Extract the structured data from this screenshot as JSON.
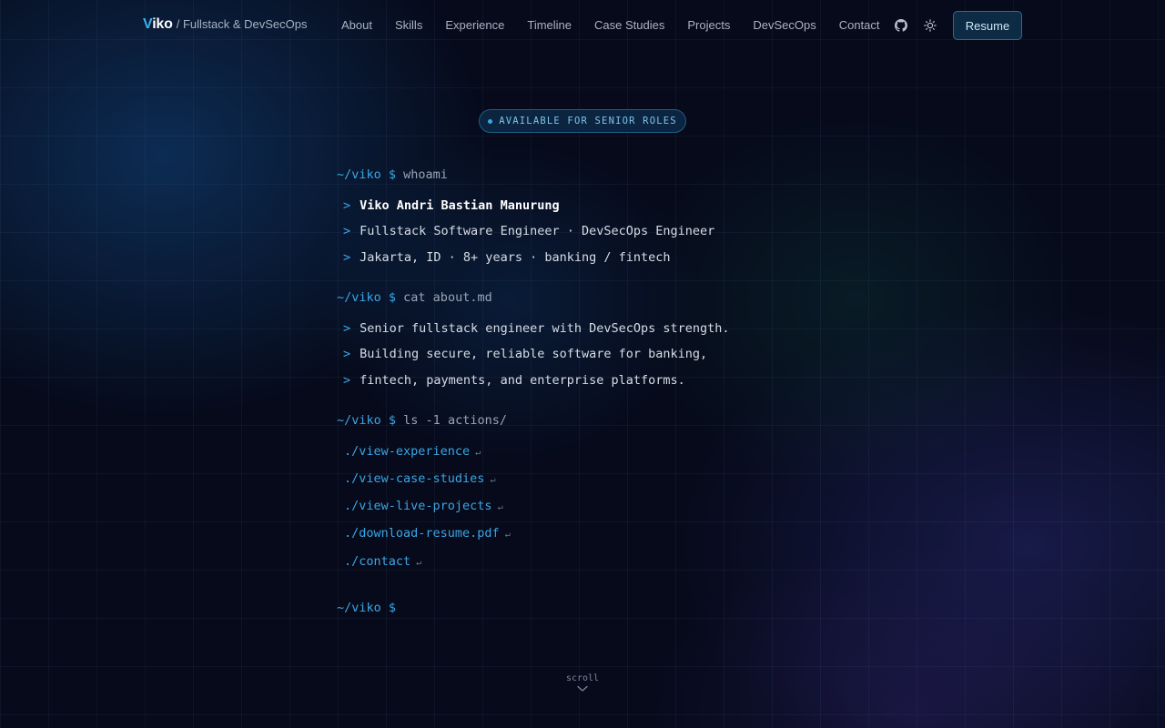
{
  "nav": {
    "brand_name": "iko",
    "brand_initial": "V",
    "brand_sub": "/ Fullstack & DevSecOps",
    "links": [
      "About",
      "Skills",
      "Experience",
      "Timeline",
      "Case Studies",
      "Projects",
      "DevSecOps",
      "Contact"
    ],
    "github_icon": "github-icon",
    "theme_icon": "sun-icon",
    "resume_label": "Resume"
  },
  "badge": {
    "label": "AVAILABLE FOR SENIOR ROLES"
  },
  "terminal": {
    "path": "~/viko $",
    "blocks": [
      {
        "command": "whoami",
        "lines": [
          "Viko Andri Bastian Manurung",
          "Fullstack Software Engineer · DevSecOps Engineer",
          "Jakarta, ID · 8+ years · banking / fintech"
        ]
      },
      {
        "command": "cat about.md",
        "lines": [
          "Senior fullstack engineer with DevSecOps strength.",
          "Building secure, reliable software for banking,",
          "fintech, payments, and enterprise platforms."
        ]
      },
      {
        "command": "ls -1 actions/",
        "actions": [
          "./view-experience",
          "./view-case-studies",
          "./view-live-projects",
          "./download-resume.pdf",
          "./contact"
        ]
      }
    ],
    "line_marker": ">",
    "return_glyph": "↵",
    "final_prompt": "~/viko $"
  },
  "scroll": {
    "label": "scroll"
  },
  "colors": {
    "accent": "#3aa6e6",
    "background": "#060a1a",
    "text": "#d7dde6"
  }
}
